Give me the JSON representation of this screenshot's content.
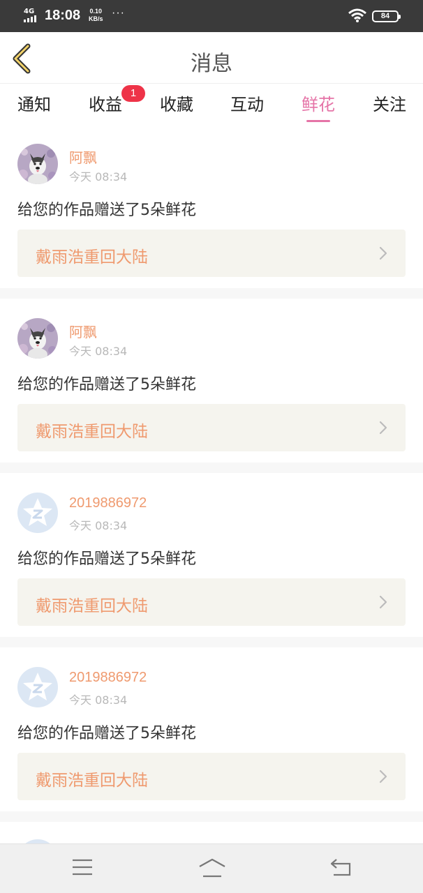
{
  "status_bar": {
    "network": "4G",
    "time": "18:08",
    "speed_value": "0.10",
    "speed_unit": "KB/s",
    "more": "···",
    "battery": "84"
  },
  "header": {
    "title": "消息",
    "back_icon": "chevron-left-icon"
  },
  "tabs": [
    {
      "label": "通知",
      "active": false
    },
    {
      "label": "收益",
      "active": false,
      "badge": "1"
    },
    {
      "label": "收藏",
      "active": false
    },
    {
      "label": "互动",
      "active": false
    },
    {
      "label": "鲜花",
      "active": true
    },
    {
      "label": "关注",
      "active": false
    }
  ],
  "messages": [
    {
      "name": "阿飘",
      "time": "今天 08:34",
      "text": "给您的作品赠送了5朵鲜花",
      "work": "戴雨浩重回大陆",
      "avatar": "husky-photo"
    },
    {
      "name": "阿飘",
      "time": "今天 08:34",
      "text": "给您的作品赠送了5朵鲜花",
      "work": "戴雨浩重回大陆",
      "avatar": "husky-photo"
    },
    {
      "name": "2019886972",
      "time": "今天 08:34",
      "text": "给您的作品赠送了5朵鲜花",
      "work": "戴雨浩重回大陆",
      "avatar": "qq-star-default"
    },
    {
      "name": "2019886972",
      "time": "今天 08:34",
      "text": "给您的作品赠送了5朵鲜花",
      "work": "戴雨浩重回大陆",
      "avatar": "qq-star-default"
    }
  ],
  "navbar": {
    "menu_icon": "menu-icon",
    "home_icon": "home-icon",
    "back_icon": "back-arrow-icon"
  },
  "colors": {
    "accent": "#e574a7",
    "name_orange": "#ef9a6f",
    "badge_red": "#ee3348",
    "work_bg": "#f5f4ee"
  }
}
